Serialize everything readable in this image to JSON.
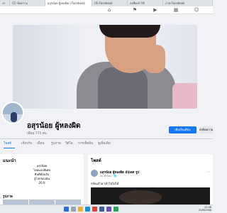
{
  "browser": {
    "tabs": [
      {
        "label": "งฯ",
        "active": false
      },
      {
        "label": "(5) ข้อความ",
        "active": false
      },
      {
        "label": "อสุรน้อย ผู้หลงผิด | Facebook",
        "active": true
      },
      {
        "label": "(9) Facebook",
        "active": false
      },
      {
        "label": "ลงชื่อเข้าใช้",
        "active": false
      },
      {
        "label": "ภาพ Facebook",
        "active": false
      }
    ]
  },
  "profile": {
    "name": "อสุรน้อย ผู้หลงผิด",
    "friends": "เพื่อน 775 คน",
    "follow_button": "เพิ่มเป็นเพื่อน",
    "message_button": "ส่งข้อความ"
  },
  "profile_tabs": [
    "โพสต์",
    "เกี่ยวกับ",
    "เพื่อน",
    "รูปภาพ",
    "วิดีโอ",
    "การเช็คอิน",
    "ดูเพิ่มเติม"
  ],
  "intro": {
    "title": "แนะนำ",
    "bio_lines": [
      "อสุรน้อย",
      "โสดแบบพิเศษ",
      "ยินดีต้อนรับ",
      "สู่โลกของฉัน",
      "20 ปี"
    ],
    "photos_label": "รูปภาพ"
  },
  "posts": {
    "title": "โพสต์",
    "author": "อสุรน้อย ผู้หลงผิด อัปเดต รูป",
    "meta": "20 ชั่วโมง · 🌐",
    "text": "กลับแล้วมาเจ้าไปไม่ได้",
    "menu": "···"
  },
  "taskbar": {
    "time": "12:48",
    "date": "24/6/2566"
  },
  "colors": {
    "accent": "#1877f2",
    "background": "#f0f2f5"
  }
}
